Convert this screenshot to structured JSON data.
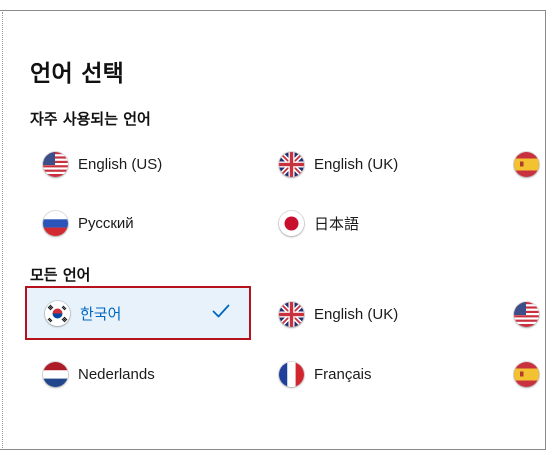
{
  "dialog": {
    "title": "언어 선택",
    "frequent_heading": "자주 사용되는 언어",
    "all_heading": "모든 언어",
    "frequent_languages": [
      {
        "label": "English (US)",
        "flag": "us-flag-icon"
      },
      {
        "label": "English (UK)",
        "flag": "uk-flag-icon"
      },
      {
        "label": "",
        "flag": "es-flag-icon"
      },
      {
        "label": "Русский",
        "flag": "ru-flag-icon"
      },
      {
        "label": "日本語",
        "flag": "jp-flag-icon"
      }
    ],
    "all_languages": [
      {
        "label": "한국어",
        "flag": "kr-flag-icon",
        "selected": true
      },
      {
        "label": "English (UK)",
        "flag": "uk-flag-icon"
      },
      {
        "label": "",
        "flag": "us-flag-icon"
      },
      {
        "label": "Nederlands",
        "flag": "nl-flag-icon"
      },
      {
        "label": "Français",
        "flag": "fr-flag-icon"
      },
      {
        "label": "",
        "flag": "es-flag-icon"
      }
    ]
  },
  "colors": {
    "selection_border": "#b5121b",
    "selection_bg": "#e8f2fb",
    "accent_text": "#0067c0"
  }
}
